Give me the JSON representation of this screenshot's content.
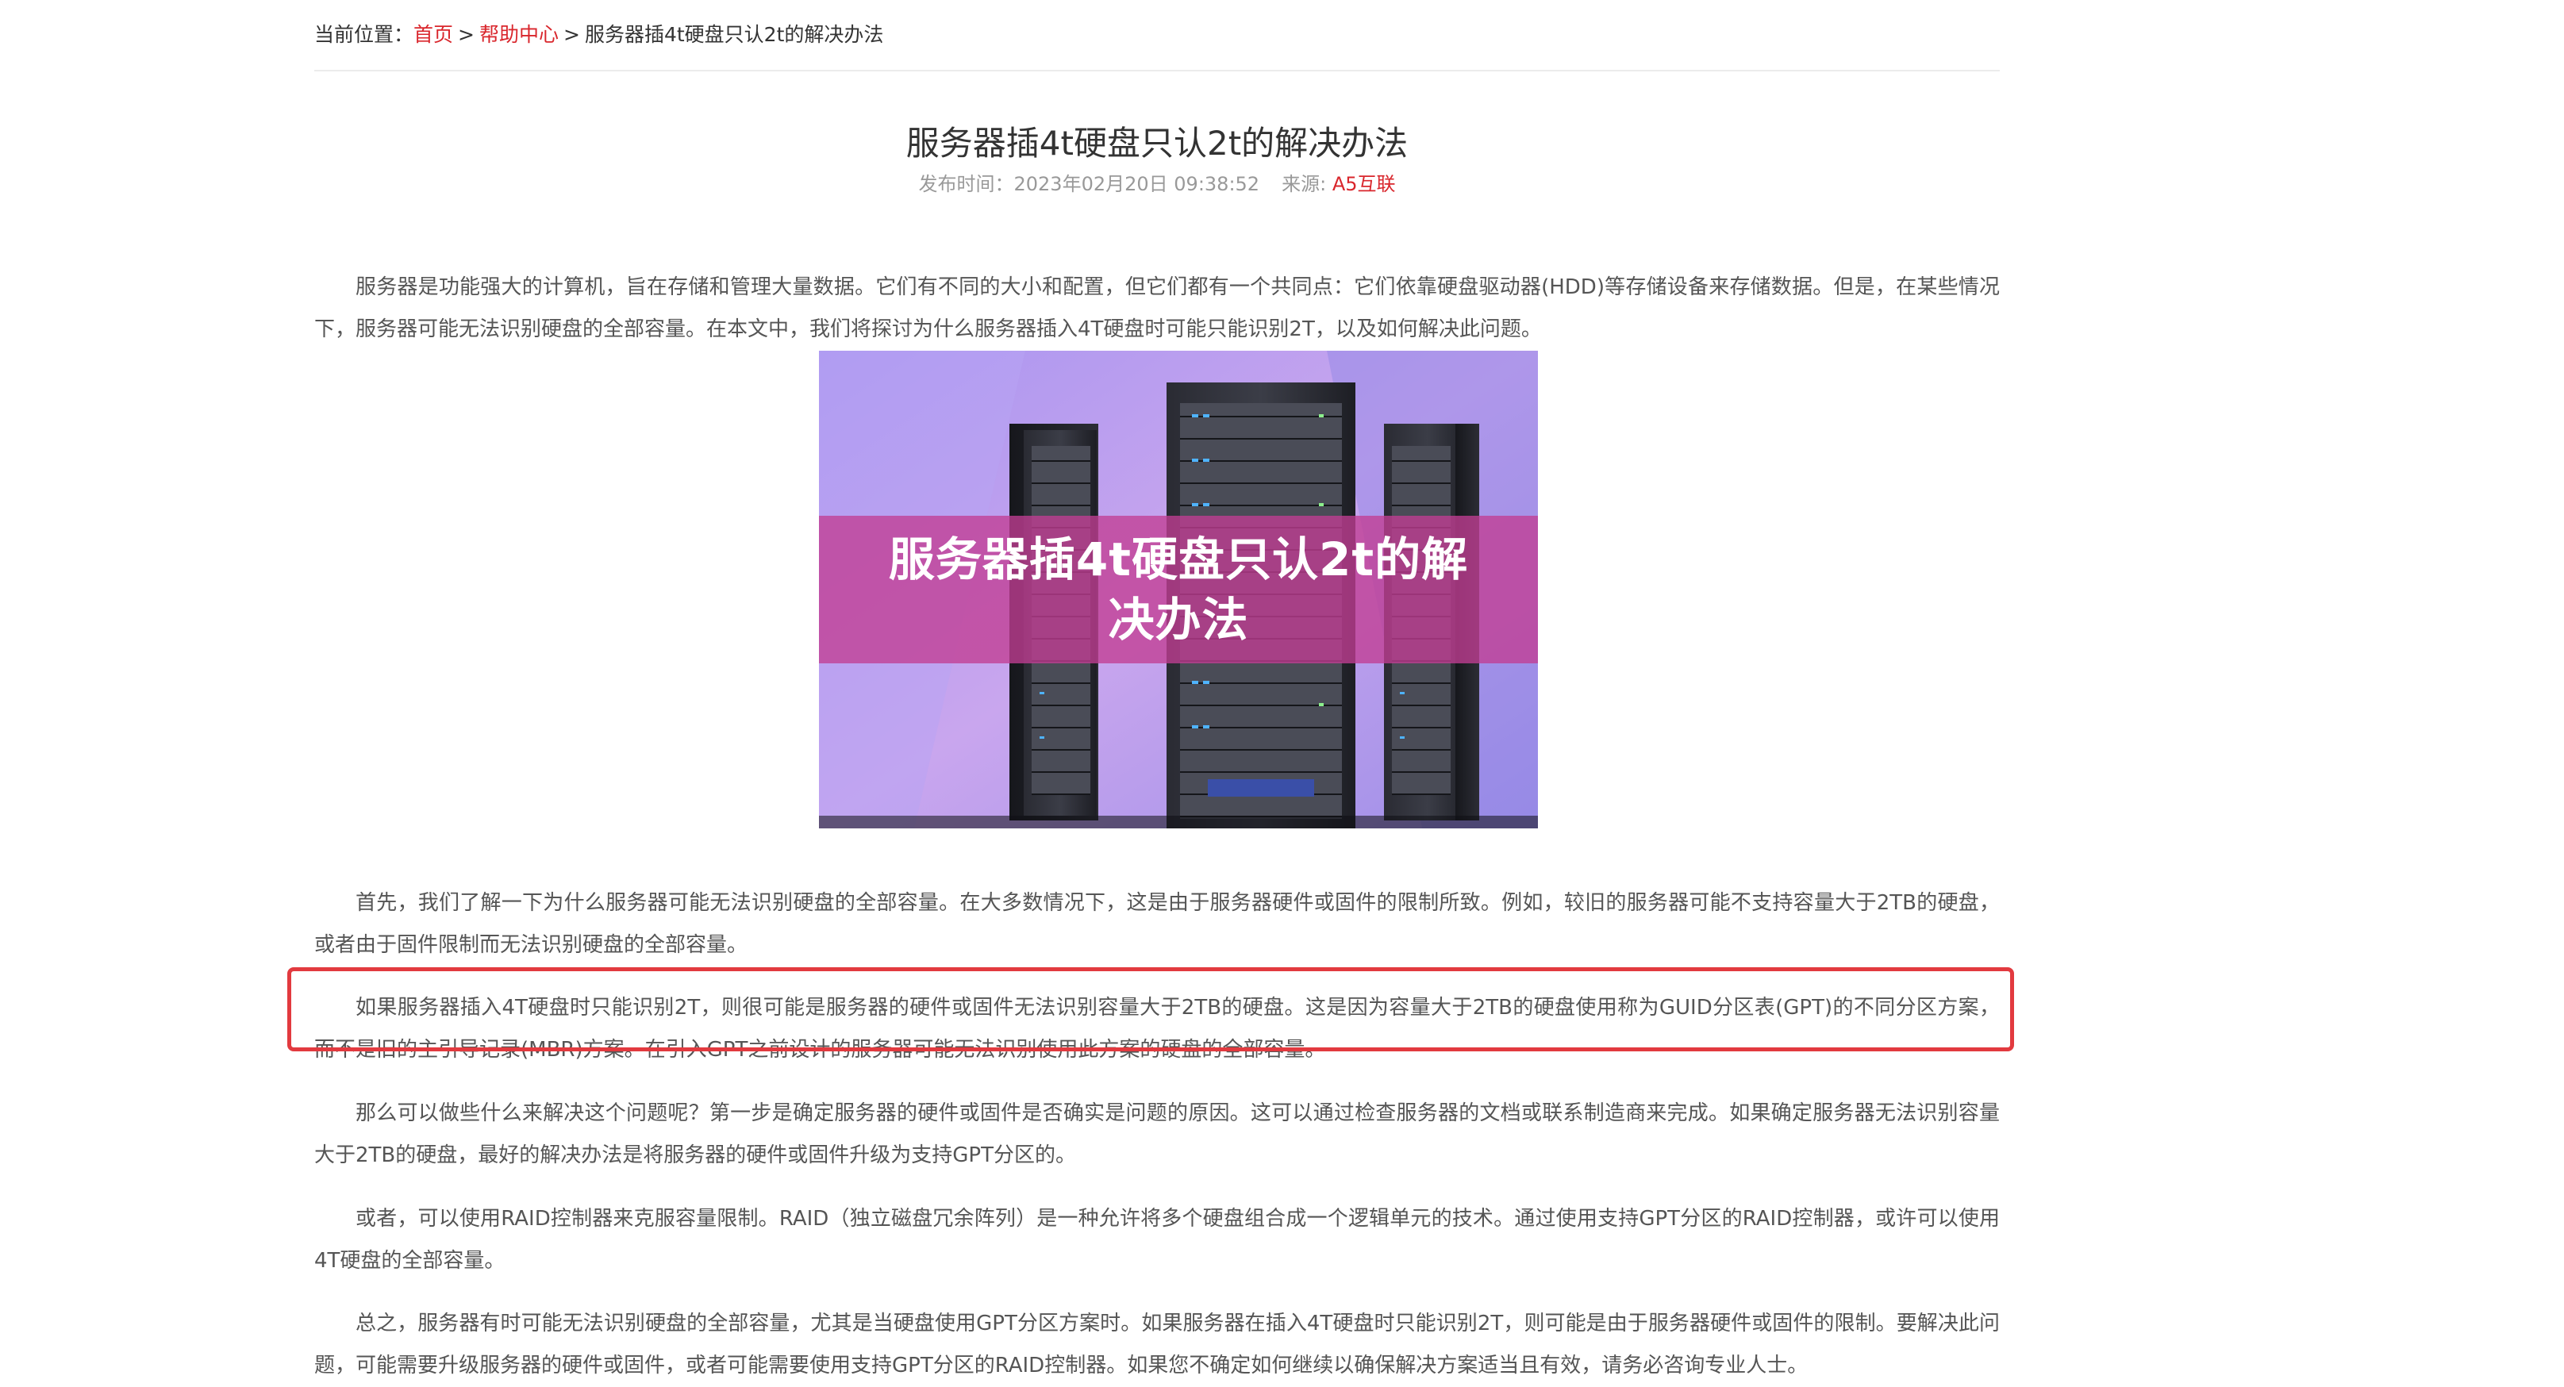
{
  "breadcrumb": {
    "prefix": "当前位置：",
    "home": "首页",
    "help": "帮助中心",
    "sep": ">",
    "current": "服务器插4t硬盘只认2t的解决办法"
  },
  "article": {
    "title": "服务器插4t硬盘只认2t的解决办法",
    "publish_label": "发布时间：",
    "publish_time": "2023年02月20日 09:38:52",
    "source_label": "来源:",
    "source_value": "A5互联",
    "image_caption": "服务器插4t硬盘只认2t的解决办法",
    "paragraphs": [
      "服务器是功能强大的计算机，旨在存储和管理大量数据。它们有不同的大小和配置，但它们都有一个共同点：它们依靠硬盘驱动器(HDD)等存储设备来存储数据。但是，在某些情况下，服务器可能无法识别硬盘的全部容量。在本文中，我们将探讨为什么服务器插入4T硬盘时可能只能识别2T，以及如何解决此问题。",
      "首先，我们了解一下为什么服务器可能无法识别硬盘的全部容量。在大多数情况下，这是由于服务器硬件或固件的限制所致。例如，较旧的服务器可能不支持容量大于2TB的硬盘，或者由于固件限制而无法识别硬盘的全部容量。",
      "如果服务器插入4T硬盘时只能识别2T，则很可能是服务器的硬件或固件无法识别容量大于2TB的硬盘。这是因为容量大于2TB的硬盘使用称为GUID分区表(GPT)的不同分区方案，而不是旧的主引导记录(MBR)方案。在引入GPT之前设计的服务器可能无法识别使用此方案的硬盘的全部容量。",
      "那么可以做些什么来解决这个问题呢？第一步是确定服务器的硬件或固件是否确实是问题的原因。这可以通过检查服务器的文档或联系制造商来完成。如果确定服务器无法识别容量大于2TB的硬盘，最好的解决办法是将服务器的硬件或固件升级为支持GPT分区的。",
      "或者，可以使用RAID控制器来克服容量限制。RAID（独立磁盘冗余阵列）是一种允许将多个硬盘组合成一个逻辑单元的技术。通过使用支持GPT分区的RAID控制器，或许可以使用4T硬盘的全部容量。",
      "总之，服务器有时可能无法识别硬盘的全部容量，尤其是当硬盘使用GPT分区方案时。如果服务器在插入4T硬盘时只能识别2T，则可能是由于服务器硬件或固件的限制。要解决此问题，可能需要升级服务器的硬件或固件，或者可能需要使用支持GPT分区的RAID控制器。如果您不确定如何继续以确保解决方案适当且有效，请务必咨询专业人士。"
    ]
  },
  "colors": {
    "link_red": "#d9262c",
    "highlight_border": "#e23a3f",
    "caption_band": "#c23e94"
  }
}
